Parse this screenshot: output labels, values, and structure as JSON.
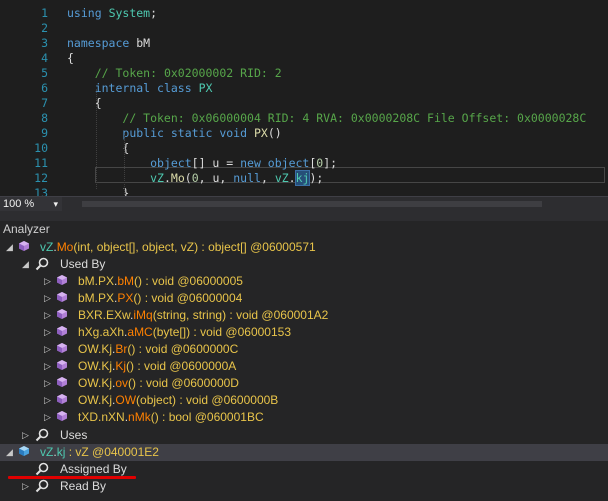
{
  "editor": {
    "lines": [
      {
        "n": "1",
        "parts": [
          [
            "kw",
            "using"
          ],
          [
            "tx",
            " "
          ],
          [
            "ns",
            "System"
          ],
          [
            "tx",
            ";"
          ]
        ]
      },
      {
        "n": "2",
        "parts": []
      },
      {
        "n": "3",
        "parts": [
          [
            "kw",
            "namespace"
          ],
          [
            "tx",
            " bM"
          ]
        ]
      },
      {
        "n": "4",
        "parts": [
          [
            "tx",
            "{"
          ]
        ]
      },
      {
        "n": "5",
        "parts": [
          [
            "tx",
            "    "
          ],
          [
            "cm",
            "// Token: 0x02000002 RID: 2"
          ]
        ]
      },
      {
        "n": "6",
        "parts": [
          [
            "tx",
            "    "
          ],
          [
            "kw",
            "internal class"
          ],
          [
            "tx",
            " "
          ],
          [
            "ty",
            "PX"
          ]
        ]
      },
      {
        "n": "7",
        "parts": [
          [
            "tx",
            "    {"
          ]
        ]
      },
      {
        "n": "8",
        "parts": [
          [
            "tx",
            "        "
          ],
          [
            "cm",
            "// Token: 0x06000004 RID: 4 RVA: 0x0000208C File Offset: 0x0000028C"
          ]
        ]
      },
      {
        "n": "9",
        "parts": [
          [
            "tx",
            "        "
          ],
          [
            "kw",
            "public static void"
          ],
          [
            "tx",
            " "
          ],
          [
            "fn",
            "PX"
          ],
          [
            "tx",
            "()"
          ]
        ]
      },
      {
        "n": "10",
        "parts": [
          [
            "tx",
            "        {"
          ]
        ]
      },
      {
        "n": "11",
        "parts": [
          [
            "tx",
            "            "
          ],
          [
            "kw",
            "object"
          ],
          [
            "tx",
            "[] u = "
          ],
          [
            "kw",
            "new object"
          ],
          [
            "tx",
            "["
          ],
          [
            "num",
            "0"
          ],
          [
            "tx",
            "];"
          ]
        ]
      },
      {
        "n": "12",
        "parts": [
          [
            "tx",
            "            "
          ],
          [
            "ty",
            "vZ"
          ],
          [
            "tx",
            "."
          ],
          [
            "fn",
            "Mo"
          ],
          [
            "tx",
            "("
          ],
          [
            "num",
            "0"
          ],
          [
            "tx",
            ", u, "
          ],
          [
            "kw",
            "null"
          ],
          [
            "tx",
            ", "
          ],
          [
            "ty",
            "vZ"
          ],
          [
            "tx",
            "."
          ],
          [
            "sel",
            "kj"
          ],
          [
            "tx",
            ");"
          ]
        ]
      },
      {
        "n": "13",
        "parts": [
          [
            "tx",
            "        }"
          ]
        ]
      }
    ]
  },
  "status": {
    "zoom": "100 %",
    "zoom_arrow": "▾"
  },
  "analyzer": {
    "title": "Analyzer",
    "root_method": {
      "name_class": "vZ",
      "name_method": "Mo",
      "signature": "(int, object[], object, vZ) : object[] @06000571"
    },
    "used_by_label": "Used By",
    "used_by": [
      {
        "cls": "bM.PX",
        "mth": "bM",
        "sig": "() : void @06000005"
      },
      {
        "cls": "bM.PX",
        "mth": "PX",
        "sig": "() : void @06000004"
      },
      {
        "cls": "BXR.EXw",
        "mth": "iMq",
        "sig": "(string, string) : void @060001A2"
      },
      {
        "cls": "hXg.aXh",
        "mth": "aMC",
        "sig": "(byte[]) : void @06000153"
      },
      {
        "cls": "OW.Kj",
        "mth": "Br",
        "sig": "() : void @0600000C"
      },
      {
        "cls": "OW.Kj",
        "mth": "Kj",
        "sig": "() : void @0600000A"
      },
      {
        "cls": "OW.Kj",
        "mth": "ov",
        "sig": "() : void @0600000D"
      },
      {
        "cls": "OW.Kj",
        "mth": "OW",
        "sig": "(object) : void @0600000B"
      },
      {
        "cls": "tXD.nXN",
        "mth": "nMk",
        "sig": "() : bool @060001BC"
      }
    ],
    "uses_label": "Uses",
    "field": {
      "cls": "vZ",
      "name": "kj",
      "rest": " : vZ @040001E2"
    },
    "assigned_by_label": "Assigned By",
    "read_by_label": "Read By",
    "colors": {
      "accent_red": "#e00000",
      "type": "#4ec9b0",
      "method": "#ff8000"
    }
  }
}
